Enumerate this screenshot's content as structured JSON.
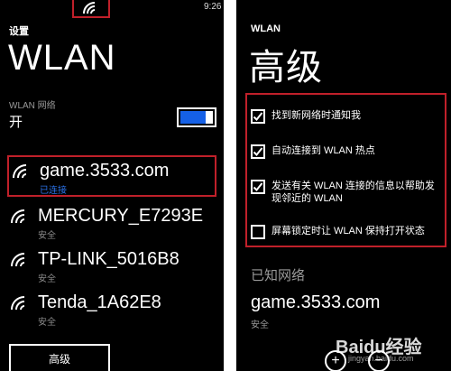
{
  "left": {
    "status": {
      "time": "9:26"
    },
    "header": "设置",
    "title": "WLAN",
    "wlan_label": "WLAN 网络",
    "toggle_state": "开",
    "networks": [
      {
        "name": "game.3533.com",
        "status": "已连接"
      },
      {
        "name": "MERCURY_E7293E",
        "status": "安全"
      },
      {
        "name": "TP-LINK_5016B8",
        "status": "安全"
      },
      {
        "name": "Tenda_1A62E8",
        "status": "安全"
      }
    ],
    "advanced_button": "高级"
  },
  "right": {
    "header": "WLAN",
    "title": "高级",
    "options": [
      {
        "label": "找到新网络时通知我",
        "checked": true
      },
      {
        "label": "自动连接到 WLAN 热点",
        "checked": true
      },
      {
        "label": "发送有关 WLAN 连接的信息以帮助发现邻近的 WLAN",
        "checked": true
      },
      {
        "label": "屏幕锁定时让 WLAN 保持打开状态",
        "checked": false
      }
    ],
    "known_title": "已知网络",
    "known_networks": [
      {
        "name": "game.3533.com",
        "status": "安全"
      }
    ],
    "watermark": "Baidu经验",
    "watermark_url": "jingyan.baidu.com"
  },
  "colors": {
    "accent_blue": "#1560e6",
    "highlight_red": "#c0202a",
    "background": "#000000"
  },
  "icons": [
    "wifi-icon",
    "checkbox-checked-icon",
    "checkbox-empty-icon",
    "add-icon",
    "minus-icon"
  ]
}
